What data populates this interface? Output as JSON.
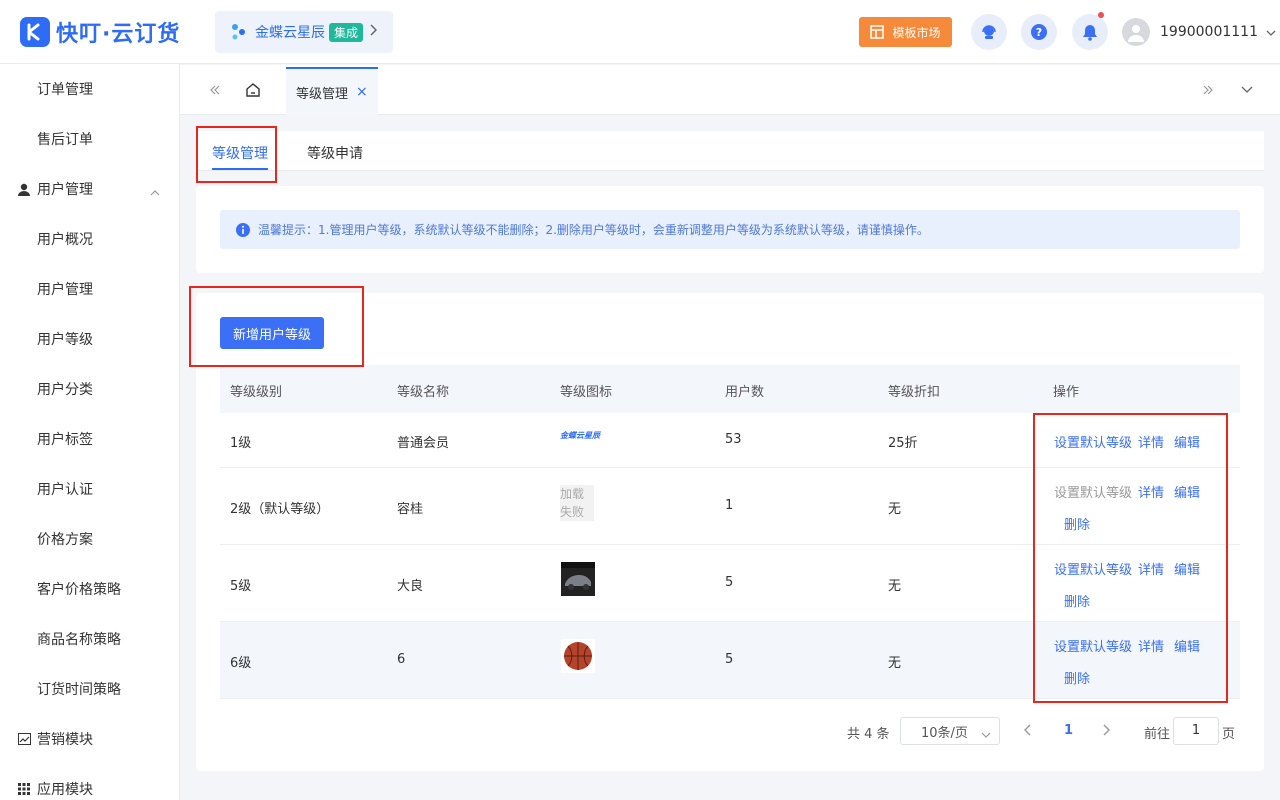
{
  "header": {
    "logo_text": "快叮·云订货",
    "brand_name": "金蝶云星辰",
    "brand_badge": "集成",
    "market_label": "模板市场",
    "user_phone": "19900001111",
    "accent": "#2f6cf6"
  },
  "sidebar": {
    "items": [
      {
        "label": "订单管理",
        "kind": "sub"
      },
      {
        "label": "售后订单",
        "kind": "sub"
      },
      {
        "label": "用户管理",
        "kind": "group",
        "icon": "user-icon",
        "expanded": true
      },
      {
        "label": "用户概况",
        "kind": "sub"
      },
      {
        "label": "用户管理",
        "kind": "sub"
      },
      {
        "label": "用户等级",
        "kind": "sub"
      },
      {
        "label": "用户分类",
        "kind": "sub"
      },
      {
        "label": "用户标签",
        "kind": "sub"
      },
      {
        "label": "用户认证",
        "kind": "sub"
      },
      {
        "label": "价格方案",
        "kind": "sub"
      },
      {
        "label": "客户价格策略",
        "kind": "sub"
      },
      {
        "label": "商品名称策略",
        "kind": "sub"
      },
      {
        "label": "订货时间策略",
        "kind": "sub"
      },
      {
        "label": "营销模块",
        "kind": "group",
        "icon": "chart-icon"
      },
      {
        "label": "应用模块",
        "kind": "group",
        "icon": "grid-icon"
      }
    ]
  },
  "tabbar": {
    "active_tab": "等级管理"
  },
  "subtabs": {
    "items": [
      "等级管理",
      "等级申请"
    ],
    "active": "等级管理"
  },
  "tip": {
    "text": "温馨提示：1.管理用户等级，系统默认等级不能删除；2.删除用户等级时，会重新调整用户等级为系统默认等级，请谨慎操作。"
  },
  "actions": {
    "add_label": "新增用户等级"
  },
  "table": {
    "headers": [
      "等级级别",
      "等级名称",
      "等级图标",
      "用户数",
      "等级折扣",
      "操作"
    ],
    "rows": [
      {
        "level": "1级",
        "name": "普通会员",
        "icon": "金蝶云星辰",
        "users": "53",
        "discount": "25折",
        "ops": {
          "set_default": "设置默认等级",
          "detail": "详情",
          "edit": "编辑"
        }
      },
      {
        "level": "2级（默认等级）",
        "name": "容桂",
        "icon_fail_1": "加载",
        "icon_fail_2": "失败",
        "users": "1",
        "discount": "无",
        "ops": {
          "set_default": "设置默认等级",
          "detail": "详情",
          "edit": "编辑",
          "delete": "删除"
        }
      },
      {
        "level": "5级",
        "name": "大良",
        "icon": "car-image",
        "users": "5",
        "discount": "无",
        "ops": {
          "set_default": "设置默认等级",
          "detail": "详情",
          "edit": "编辑",
          "delete": "删除"
        }
      },
      {
        "level": "6级",
        "name": "6",
        "icon": "basketball-image",
        "users": "5",
        "discount": "无",
        "ops": {
          "set_default": "设置默认等级",
          "detail": "详情",
          "edit": "编辑",
          "delete": "删除"
        }
      }
    ]
  },
  "pagination": {
    "total": "共 4 条",
    "page_size": "10条/页",
    "current_page": "1",
    "goto_label": "前往",
    "goto_value": "1",
    "page_suffix": "页"
  }
}
